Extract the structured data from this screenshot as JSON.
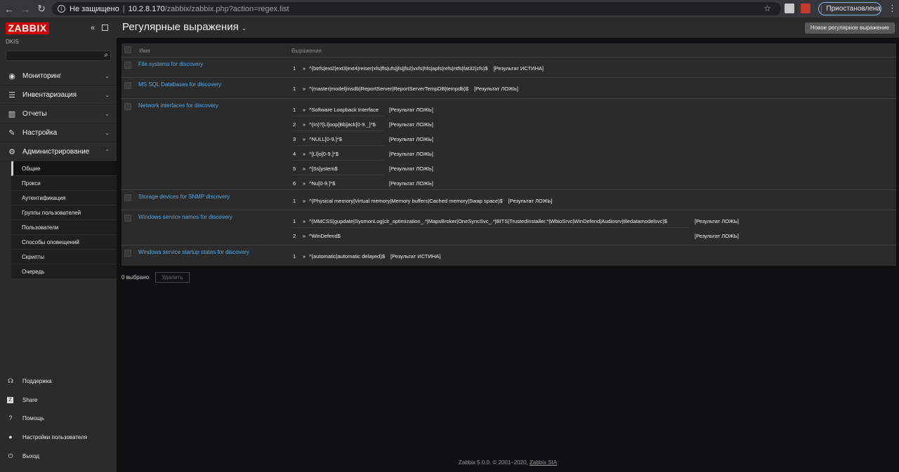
{
  "browser": {
    "security_label": "Не защищено",
    "url_host": "10.2.8.170",
    "url_path": "/zabbix/zabbix.php?action=regex.list",
    "profile_label": "Приостановлена"
  },
  "sidebar": {
    "logo": "ZABBIX",
    "org": "DKIS",
    "search_value": "",
    "menu": [
      {
        "label": "Мониторинг",
        "icon": "eye-icon"
      },
      {
        "label": "Инвентаризация",
        "icon": "list-icon"
      },
      {
        "label": "Отчеты",
        "icon": "chart-icon"
      },
      {
        "label": "Настройка",
        "icon": "wrench-icon"
      },
      {
        "label": "Администрирование",
        "icon": "gear-icon"
      }
    ],
    "submenu": [
      "Общие",
      "Прокси",
      "Аутентификация",
      "Группы пользователей",
      "Пользователи",
      "Способы оповещений",
      "Скрипты",
      "Очередь"
    ],
    "footer": [
      {
        "label": "Поддержка",
        "icon": "headset-icon"
      },
      {
        "label": "Share",
        "icon": "share-icon"
      },
      {
        "label": "Помощь",
        "icon": "help-icon"
      },
      {
        "label": "Настройки пользователя",
        "icon": "user-icon"
      },
      {
        "label": "Выход",
        "icon": "power-icon"
      }
    ]
  },
  "header": {
    "title": "Регулярные выражения",
    "new_button": "Новое регулярное выражение"
  },
  "table": {
    "col_name": "Имя",
    "col_expressions": "Выражения",
    "rows": [
      {
        "name": "File systems for discovery",
        "expressions": [
          {
            "num": "1",
            "arrow": "»",
            "expr": "^(btrfs|ext2|ext3|ext4|reiser|xfs|ffs|ufs|jfs|jfs2|vxfs|hfs|apfs|refs|ntfs|fat32|zfs)$",
            "result": "[Результат ИСТИНА]"
          }
        ]
      },
      {
        "name": "MS SQL Databases for discovery",
        "expressions": [
          {
            "num": "1",
            "arrow": "»",
            "expr": "^(master|model|msdb|ReportServer|ReportServerTempDB|tempdb)$",
            "result": "[Результат ЛОЖЬ]"
          }
        ]
      },
      {
        "name": "Network interfaces for discovery",
        "expressions": [
          {
            "num": "1",
            "arrow": "»",
            "expr": "^Software Loopback Interface",
            "result": "[Результат ЛОЖЬ]"
          },
          {
            "num": "2",
            "arrow": "»",
            "expr": "^(In)?[Ll]oop[Bb]ack[0-9._]*$",
            "result": "[Результат ЛОЖЬ]"
          },
          {
            "num": "3",
            "arrow": "»",
            "expr": "^NULL[0-9.]*$",
            "result": "[Результат ЛОЖЬ]"
          },
          {
            "num": "4",
            "arrow": "»",
            "expr": "^[Ll]o[0-9.]*$",
            "result": "[Результат ЛОЖЬ]"
          },
          {
            "num": "5",
            "arrow": "»",
            "expr": "^[Ss]ystem$",
            "result": "[Результат ЛОЖЬ]"
          },
          {
            "num": "6",
            "arrow": "»",
            "expr": "^Nu[0-9.]*$",
            "result": "[Результат ЛОЖЬ]"
          }
        ]
      },
      {
        "name": "Storage devices for SNMP discovery",
        "expressions": [
          {
            "num": "1",
            "arrow": "»",
            "expr": "^(Physical memory|Virtual memory|Memory buffers|Cached memory|Swap space)$",
            "result": "[Результат ЛОЖЬ]"
          }
        ]
      },
      {
        "name": "Windows service names for discovery",
        "expressions": [
          {
            "num": "1",
            "arrow": "»",
            "expr": "^(MMCSS|gupdate|SysmonLog|clr_optimization_.*|MapsBroker|OneSyncSvc_.*|BITS|TrustedInstaller.*|WbioSrvc|WinDefend|Audiosrv|tiledatamodelsvc)$",
            "result": "[Результат ЛОЖЬ]"
          },
          {
            "num": "2",
            "arrow": "»",
            "expr": "^WinDefend$",
            "result": "[Результат ЛОЖЬ]"
          }
        ]
      },
      {
        "name": "Windows service startup states for discovery",
        "expressions": [
          {
            "num": "1",
            "arrow": "»",
            "expr": "^(automatic|automatic delayed)$",
            "result": "[Результат ИСТИНА]"
          }
        ]
      }
    ]
  },
  "below_table": {
    "selected": "0 выбрано",
    "delete_button": "Удалить"
  },
  "footer": {
    "text": "Zabbix 5.0.0. © 2001–2020, ",
    "link": "Zabbix SIA"
  }
}
